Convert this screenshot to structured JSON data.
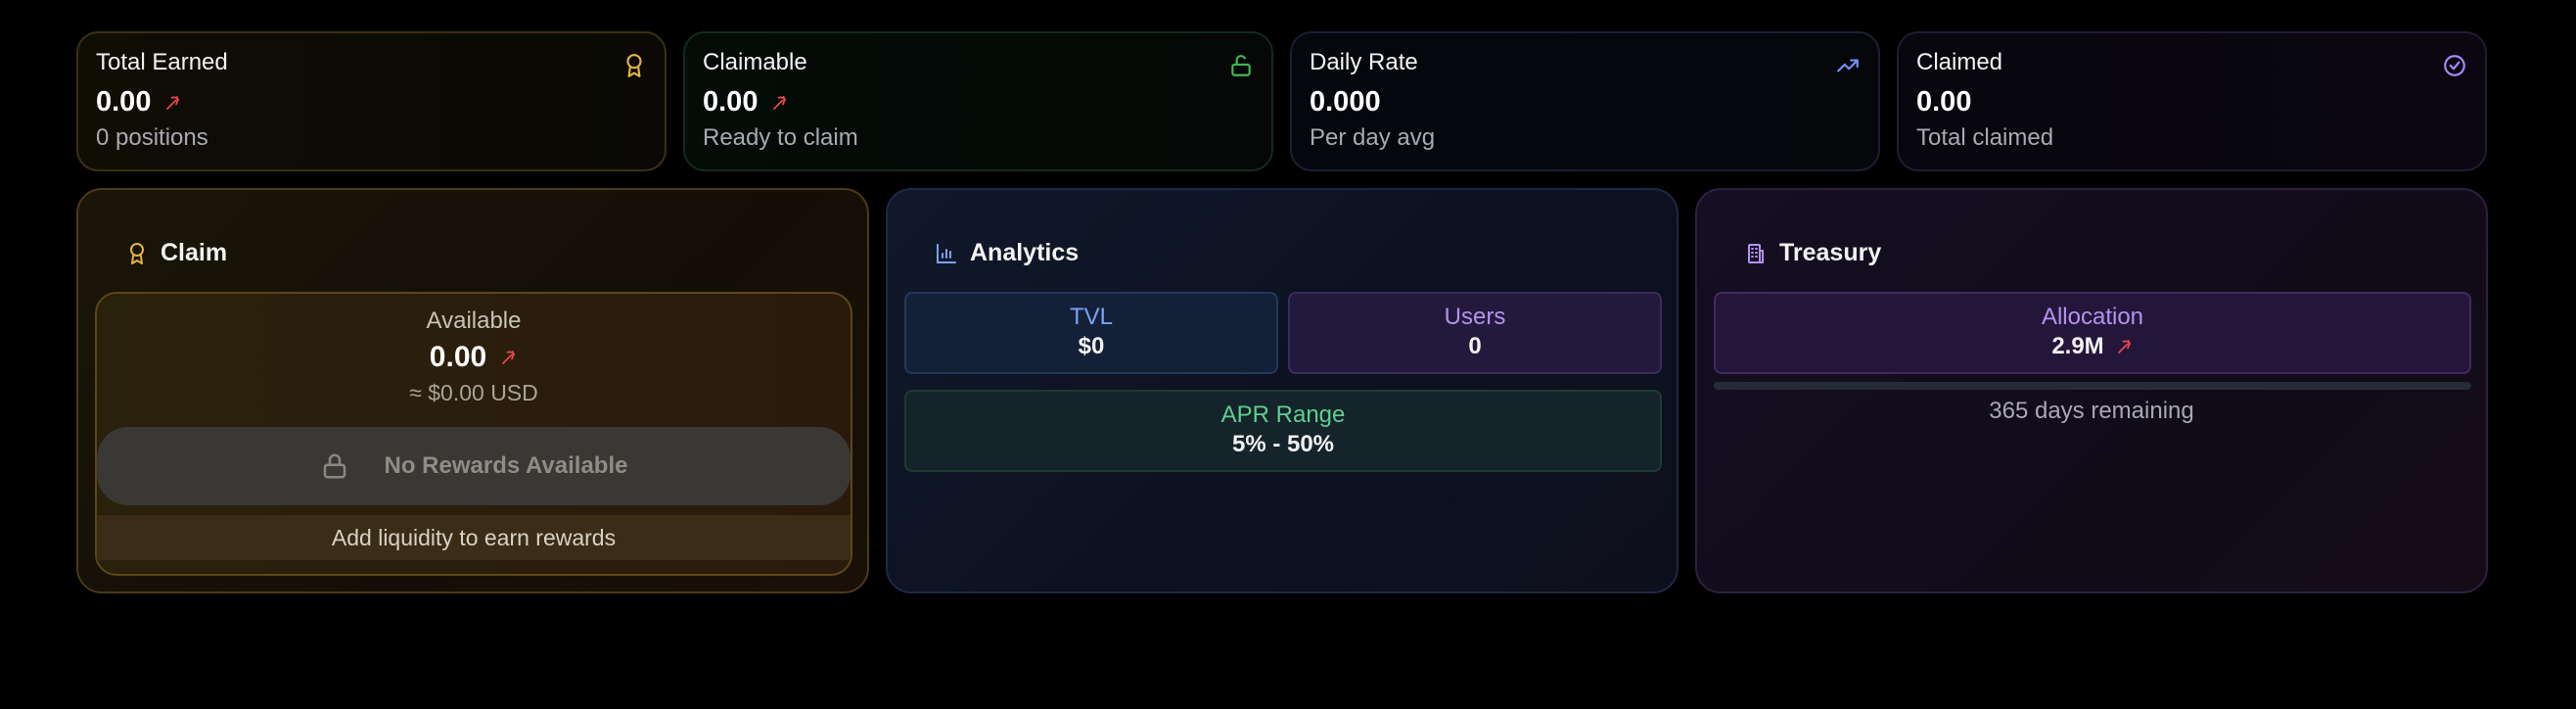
{
  "stats": [
    {
      "title": "Total Earned",
      "value": "0.00",
      "sub": "0 positions",
      "icon": "award-icon",
      "accent": "#e3b341",
      "trend": true
    },
    {
      "title": "Claimable",
      "value": "0.00",
      "sub": "Ready to claim",
      "icon": "unlock-icon",
      "accent": "#3fb950",
      "trend": true
    },
    {
      "title": "Daily Rate",
      "value": "0.000",
      "sub": "Per day avg",
      "icon": "trending-up-icon",
      "accent": "#7a8cff",
      "trend": false
    },
    {
      "title": "Claimed",
      "value": "0.00",
      "sub": "Total claimed",
      "icon": "check-circle-icon",
      "accent": "#a78bfa",
      "trend": false
    }
  ],
  "claim": {
    "title": "Claim",
    "available_label": "Available",
    "available_value": "0.00",
    "usd": "≈ $0.00 USD",
    "button_label": "No Rewards Available",
    "hint": "Add liquidity to earn rewards"
  },
  "analytics": {
    "title": "Analytics",
    "tvl_label": "TVL",
    "tvl_value": "$0",
    "users_label": "Users",
    "users_value": "0",
    "apr_label": "APR Range",
    "apr_value": "5% - 50%"
  },
  "treasury": {
    "title": "Treasury",
    "allocation_label": "Allocation",
    "allocation_value": "2.9M",
    "progress": 0,
    "remaining": "365 days remaining"
  },
  "colors": {
    "gold": "#e3b341",
    "green": "#3fb950",
    "blue": "#7aa2f7",
    "purple": "#b392f0",
    "red": "#e5484d"
  }
}
